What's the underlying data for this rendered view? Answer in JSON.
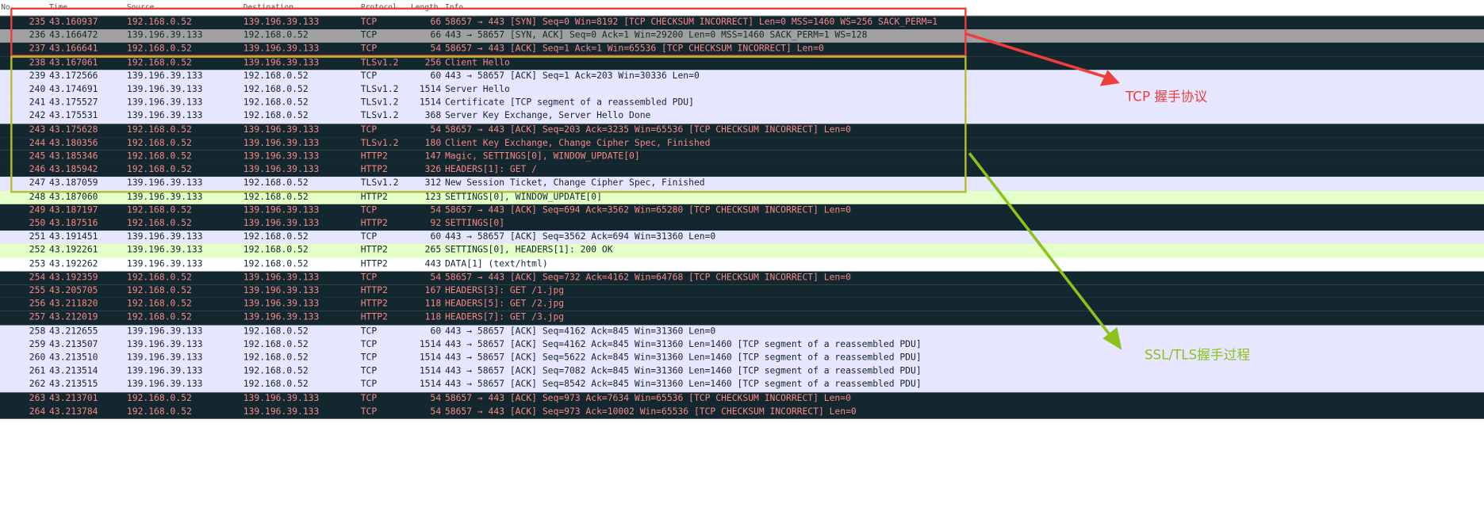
{
  "header": {
    "no": "No.",
    "time": "Time",
    "source": "Source",
    "destination": "Destination",
    "protocol": "Protocol",
    "length": "Length",
    "info": "Info"
  },
  "packets": [
    {
      "no": "235",
      "time": "43.160937",
      "src": "192.168.0.52",
      "dst": "139.196.39.133",
      "proto": "TCP",
      "len": "66",
      "info": "58657 → 443 [SYN] Seq=0 Win=8192 [TCP CHECKSUM INCORRECT] Len=0 MSS=1460 WS=256 SACK_PERM=1",
      "style": "dark"
    },
    {
      "no": "236",
      "time": "43.166472",
      "src": "139.196.39.133",
      "dst": "192.168.0.52",
      "proto": "TCP",
      "len": "66",
      "info": "443 → 58657 [SYN, ACK] Seq=0 Ack=1 Win=29200 Len=0 MSS=1460 SACK_PERM=1 WS=128",
      "style": "gray"
    },
    {
      "no": "237",
      "time": "43.166641",
      "src": "192.168.0.52",
      "dst": "139.196.39.133",
      "proto": "TCP",
      "len": "54",
      "info": "58657 → 443 [ACK] Seq=1 Ack=1 Win=65536 [TCP CHECKSUM INCORRECT] Len=0",
      "style": "dark"
    },
    {
      "no": "238",
      "time": "43.167061",
      "src": "192.168.0.52",
      "dst": "139.196.39.133",
      "proto": "TLSv1.2",
      "len": "256",
      "info": "Client Hello",
      "style": "dark"
    },
    {
      "no": "239",
      "time": "43.172566",
      "src": "139.196.39.133",
      "dst": "192.168.0.52",
      "proto": "TCP",
      "len": "60",
      "info": "443 → 58657 [ACK] Seq=1 Ack=203 Win=30336 Len=0",
      "style": "light"
    },
    {
      "no": "240",
      "time": "43.174691",
      "src": "139.196.39.133",
      "dst": "192.168.0.52",
      "proto": "TLSv1.2",
      "len": "1514",
      "info": "Server Hello",
      "style": "light"
    },
    {
      "no": "241",
      "time": "43.175527",
      "src": "139.196.39.133",
      "dst": "192.168.0.52",
      "proto": "TLSv1.2",
      "len": "1514",
      "info": "Certificate [TCP segment of a reassembled PDU]",
      "style": "light"
    },
    {
      "no": "242",
      "time": "43.175531",
      "src": "139.196.39.133",
      "dst": "192.168.0.52",
      "proto": "TLSv1.2",
      "len": "368",
      "info": "Server Key Exchange, Server Hello Done",
      "style": "light"
    },
    {
      "no": "243",
      "time": "43.175628",
      "src": "192.168.0.52",
      "dst": "139.196.39.133",
      "proto": "TCP",
      "len": "54",
      "info": "58657 → 443 [ACK] Seq=203 Ack=3235 Win=65536 [TCP CHECKSUM INCORRECT] Len=0",
      "style": "dark"
    },
    {
      "no": "244",
      "time": "43.180356",
      "src": "192.168.0.52",
      "dst": "139.196.39.133",
      "proto": "TLSv1.2",
      "len": "180",
      "info": "Client Key Exchange, Change Cipher Spec, Finished",
      "style": "dark"
    },
    {
      "no": "245",
      "time": "43.185346",
      "src": "192.168.0.52",
      "dst": "139.196.39.133",
      "proto": "HTTP2",
      "len": "147",
      "info": "Magic, SETTINGS[0], WINDOW_UPDATE[0]",
      "style": "dark"
    },
    {
      "no": "246",
      "time": "43.185942",
      "src": "192.168.0.52",
      "dst": "139.196.39.133",
      "proto": "HTTP2",
      "len": "326",
      "info": "HEADERS[1]: GET /",
      "style": "dark"
    },
    {
      "no": "247",
      "time": "43.187059",
      "src": "139.196.39.133",
      "dst": "192.168.0.52",
      "proto": "TLSv1.2",
      "len": "312",
      "info": "New Session Ticket, Change Cipher Spec, Finished",
      "style": "light"
    },
    {
      "no": "248",
      "time": "43.187060",
      "src": "139.196.39.133",
      "dst": "192.168.0.52",
      "proto": "HTTP2",
      "len": "123",
      "info": "SETTINGS[0], WINDOW_UPDATE[0]",
      "style": "green"
    },
    {
      "no": "249",
      "time": "43.187197",
      "src": "192.168.0.52",
      "dst": "139.196.39.133",
      "proto": "TCP",
      "len": "54",
      "info": "58657 → 443 [ACK] Seq=694 Ack=3562 Win=65280 [TCP CHECKSUM INCORRECT] Len=0",
      "style": "dark"
    },
    {
      "no": "250",
      "time": "43.187516",
      "src": "192.168.0.52",
      "dst": "139.196.39.133",
      "proto": "HTTP2",
      "len": "92",
      "info": "SETTINGS[0]",
      "style": "dark"
    },
    {
      "no": "251",
      "time": "43.191451",
      "src": "139.196.39.133",
      "dst": "192.168.0.52",
      "proto": "TCP",
      "len": "60",
      "info": "443 → 58657 [ACK] Seq=3562 Ack=694 Win=31360 Len=0",
      "style": "light"
    },
    {
      "no": "252",
      "time": "43.192261",
      "src": "139.196.39.133",
      "dst": "192.168.0.52",
      "proto": "HTTP2",
      "len": "265",
      "info": "SETTINGS[0], HEADERS[1]: 200 OK",
      "style": "green"
    },
    {
      "no": "253",
      "time": "43.192262",
      "src": "139.196.39.133",
      "dst": "192.168.0.52",
      "proto": "HTTP2",
      "len": "443",
      "info": "DATA[1] (text/html)",
      "style": "white"
    },
    {
      "no": "254",
      "time": "43.192359",
      "src": "192.168.0.52",
      "dst": "139.196.39.133",
      "proto": "TCP",
      "len": "54",
      "info": "58657 → 443 [ACK] Seq=732 Ack=4162 Win=64768 [TCP CHECKSUM INCORRECT] Len=0",
      "style": "dark"
    },
    {
      "no": "255",
      "time": "43.205705",
      "src": "192.168.0.52",
      "dst": "139.196.39.133",
      "proto": "HTTP2",
      "len": "167",
      "info": "HEADERS[3]: GET /1.jpg",
      "style": "dark"
    },
    {
      "no": "256",
      "time": "43.211820",
      "src": "192.168.0.52",
      "dst": "139.196.39.133",
      "proto": "HTTP2",
      "len": "118",
      "info": "HEADERS[5]: GET /2.jpg",
      "style": "dark"
    },
    {
      "no": "257",
      "time": "43.212019",
      "src": "192.168.0.52",
      "dst": "139.196.39.133",
      "proto": "HTTP2",
      "len": "118",
      "info": "HEADERS[7]: GET /3.jpg",
      "style": "dark"
    },
    {
      "no": "258",
      "time": "43.212655",
      "src": "139.196.39.133",
      "dst": "192.168.0.52",
      "proto": "TCP",
      "len": "60",
      "info": "443 → 58657 [ACK] Seq=4162 Ack=845 Win=31360 Len=0",
      "style": "light"
    },
    {
      "no": "259",
      "time": "43.213507",
      "src": "139.196.39.133",
      "dst": "192.168.0.52",
      "proto": "TCP",
      "len": "1514",
      "info": "443 → 58657 [ACK] Seq=4162 Ack=845 Win=31360 Len=1460 [TCP segment of a reassembled PDU]",
      "style": "light"
    },
    {
      "no": "260",
      "time": "43.213510",
      "src": "139.196.39.133",
      "dst": "192.168.0.52",
      "proto": "TCP",
      "len": "1514",
      "info": "443 → 58657 [ACK] Seq=5622 Ack=845 Win=31360 Len=1460 [TCP segment of a reassembled PDU]",
      "style": "light"
    },
    {
      "no": "261",
      "time": "43.213514",
      "src": "139.196.39.133",
      "dst": "192.168.0.52",
      "proto": "TCP",
      "len": "1514",
      "info": "443 → 58657 [ACK] Seq=7082 Ack=845 Win=31360 Len=1460 [TCP segment of a reassembled PDU]",
      "style": "light"
    },
    {
      "no": "262",
      "time": "43.213515",
      "src": "139.196.39.133",
      "dst": "192.168.0.52",
      "proto": "TCP",
      "len": "1514",
      "info": "443 → 58657 [ACK] Seq=8542 Ack=845 Win=31360 Len=1460 [TCP segment of a reassembled PDU]",
      "style": "light"
    },
    {
      "no": "263",
      "time": "43.213701",
      "src": "192.168.0.52",
      "dst": "139.196.39.133",
      "proto": "TCP",
      "len": "54",
      "info": "58657 → 443 [ACK] Seq=973 Ack=7634 Win=65536 [TCP CHECKSUM INCORRECT] Len=0",
      "style": "dark"
    },
    {
      "no": "264",
      "time": "43.213784",
      "src": "192.168.0.52",
      "dst": "139.196.39.133",
      "proto": "TCP",
      "len": "54",
      "info": "58657 → 443 [ACK] Seq=973 Ack=10002 Win=65536 [TCP CHECKSUM INCORRECT] Len=0",
      "style": "dark"
    }
  ],
  "annotations": {
    "tcp_label": "TCP 握手协议",
    "tls_label": "SSL/TLS握手过程",
    "tcp_color": "#f03c3c",
    "tls_color": "#8cc21b"
  },
  "colors": {
    "dark_row_bg": "#12272e",
    "dark_row_text": "#f78787",
    "light_row_bg": "#e7e6ff",
    "green_row_bg": "#e4ffc7",
    "gray_row_bg": "#a0a0a0"
  }
}
